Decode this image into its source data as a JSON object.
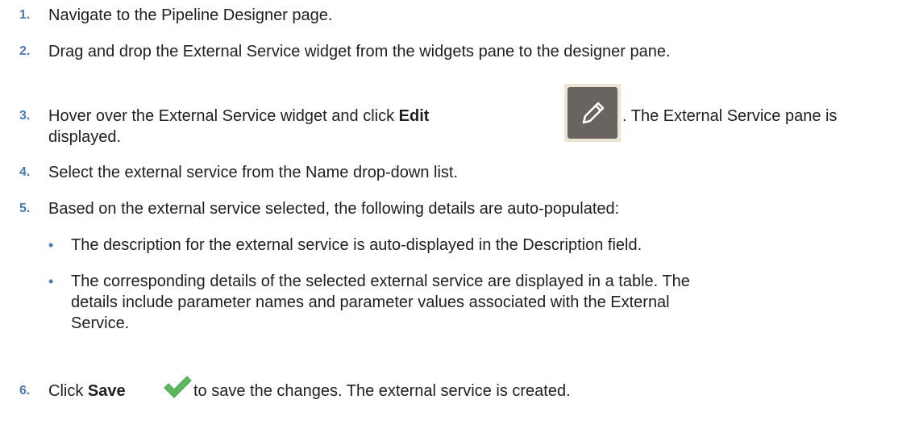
{
  "steps": [
    {
      "num": "1.",
      "text": "Navigate to the Pipeline Designer page."
    },
    {
      "num": "2.",
      "text": "Drag and drop the External Service widget from the widgets pane to the designer pane."
    },
    {
      "num": "3.",
      "pre": "Hover over the External Service widget and click ",
      "bold": "Edit",
      "post_line1": ". The External Service pane is",
      "post_line2": "displayed."
    },
    {
      "num": "4.",
      "text": "Select the external service from the Name drop-down list."
    },
    {
      "num": "5.",
      "text": "Based on the external service selected, the following details are auto-populated:"
    },
    {
      "num": "6.",
      "pre": "Click ",
      "bold": "Save",
      "post": " to save the changes. The external service is created."
    }
  ],
  "sub_items": [
    {
      "bullet": "•",
      "text": "The description for the external service is auto-displayed in the Description field."
    },
    {
      "bullet": "•",
      "line1": "The corresponding details of the selected external service are displayed in a table. The",
      "line2": "details include parameter names and parameter values associated with the External",
      "line3": "Service."
    }
  ],
  "icons": {
    "edit": "pencil-edit-icon",
    "save": "checkmark-save-icon",
    "edit_bg": "#6a6460",
    "save_color": "#5cb85c"
  }
}
